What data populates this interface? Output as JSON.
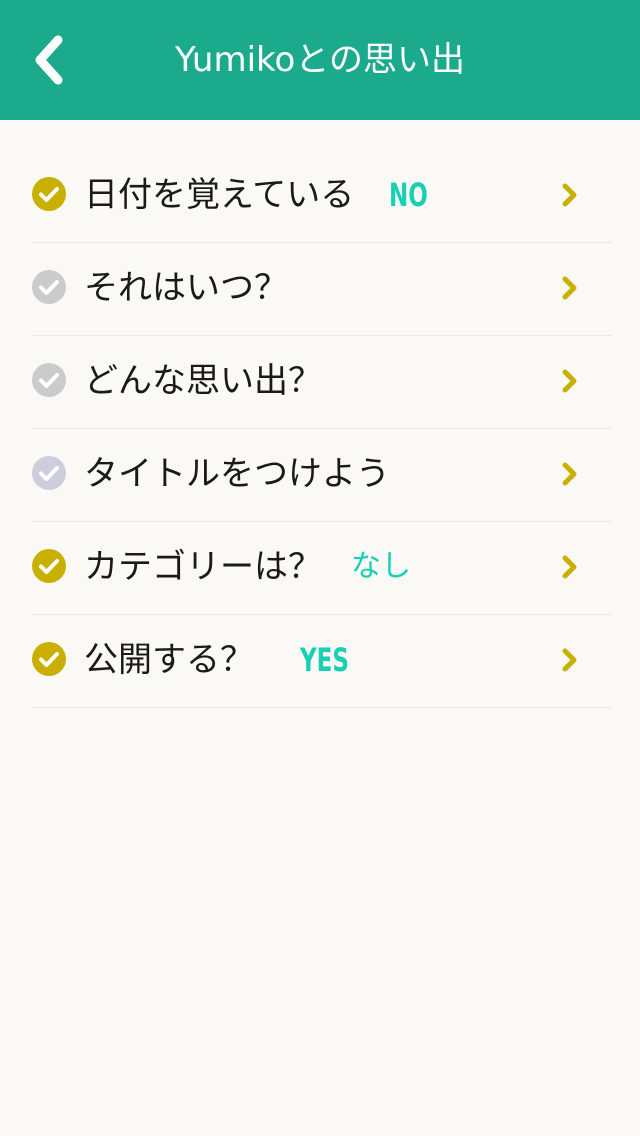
{
  "header": {
    "title": "Yumikoとの思い出",
    "back_icon": "chevron-left-icon",
    "background_color": "#1baa8b"
  },
  "rows": [
    {
      "label": "日付を覚えている",
      "value": "NO",
      "check_state": "done"
    },
    {
      "label": "それはいつ？",
      "value": "",
      "check_state": "pending"
    },
    {
      "label": "どんな思い出？",
      "value": "",
      "check_state": "pending"
    },
    {
      "label": "タイトルをつけよう",
      "value": "",
      "check_state": "pending-blue"
    },
    {
      "label": "カテゴリーは？",
      "value": "なし",
      "check_state": "done"
    },
    {
      "label": "公開する？",
      "value": "YES",
      "check_state": "done"
    }
  ],
  "colors": {
    "check_done": "#c9b000",
    "check_pending": "#cbcbcb",
    "check_pending_blue": "#cdcddb",
    "value_text": "#19d0b4",
    "chevron": "#c9b000",
    "divider": "#e9e8e3",
    "background": "#faf9f6"
  },
  "icons": {
    "check": "check-circle-icon",
    "row_arrow": "chevron-right-icon"
  }
}
